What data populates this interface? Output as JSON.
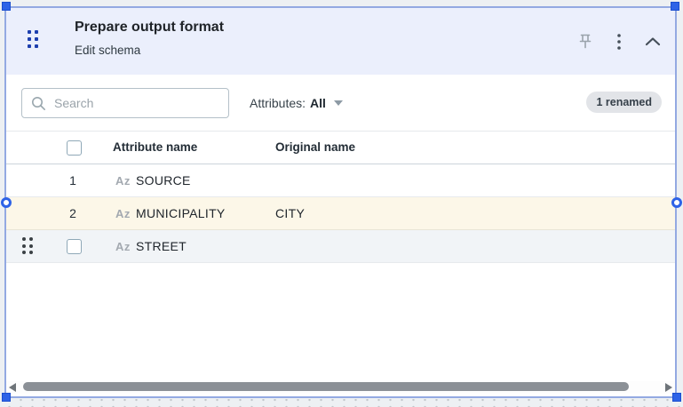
{
  "panel": {
    "title": "Prepare output format",
    "subtitle": "Edit schema"
  },
  "toolbar": {
    "search_placeholder": "Search",
    "attributes_label": "Attributes:",
    "attributes_value": "All",
    "badge": "1 renamed"
  },
  "table": {
    "columns": [
      "Attribute name",
      "Original name"
    ],
    "rows": [
      {
        "num": "1",
        "type": "Az",
        "name": "SOURCE",
        "original": ""
      },
      {
        "num": "2",
        "type": "Az",
        "name": "MUNICIPALITY",
        "original": "CITY"
      },
      {
        "num": "",
        "type": "Az",
        "name": "STREET",
        "original": ""
      }
    ]
  },
  "colors": {
    "panel_border": "#93a9e2",
    "selection_handle": "#2e63e7",
    "header_bg": "#ebeffc",
    "renamed_row_bg": "#fcf7e8",
    "hover_row_bg": "#f1f4f7",
    "badge_bg": "#e2e4e8",
    "drag_dots_blue": "#1d3fae"
  },
  "icons": {
    "header_drag": "drag-handle",
    "pin": "pin",
    "kebab": "more-options",
    "collapse": "chevron-up",
    "search": "magnifier",
    "caret": "dropdown-caret",
    "type_string": "Az"
  }
}
